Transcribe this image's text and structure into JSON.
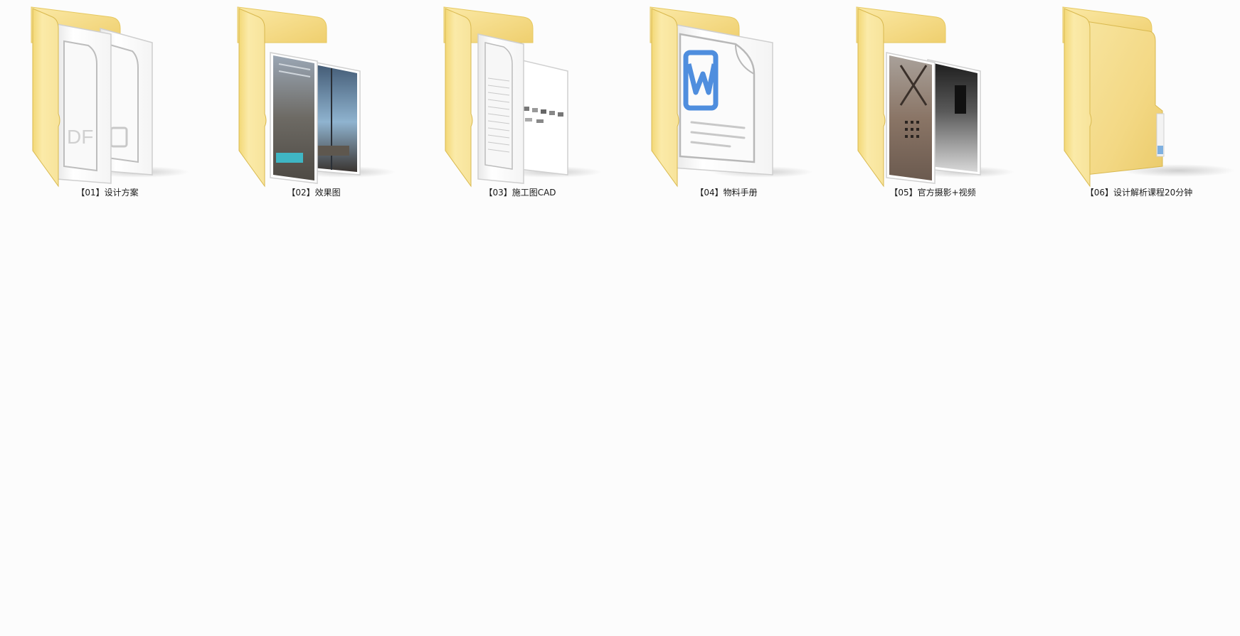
{
  "folders": [
    {
      "label": "【01】设计方案",
      "preview": "pdf-documents-icon"
    },
    {
      "label": "【02】效果图",
      "preview": "interior-render-photos-icon"
    },
    {
      "label": "【03】施工图CAD",
      "preview": "cad-drawing-sheets-icon"
    },
    {
      "label": "【04】物料手册",
      "preview": "word-document-icon"
    },
    {
      "label": "【05】官方摄影+视频",
      "preview": "photography-images-icon"
    },
    {
      "label": "【06】设计解析课程20分钟",
      "preview": "empty-folder-icon"
    }
  ],
  "colors": {
    "background": "#fcfcfc",
    "folder_back": "#f6e08f",
    "folder_front": "#f9e7a0",
    "paper": "#ffffff",
    "word_blue": "#4f8ede",
    "label_text": "#1a1a1a"
  }
}
